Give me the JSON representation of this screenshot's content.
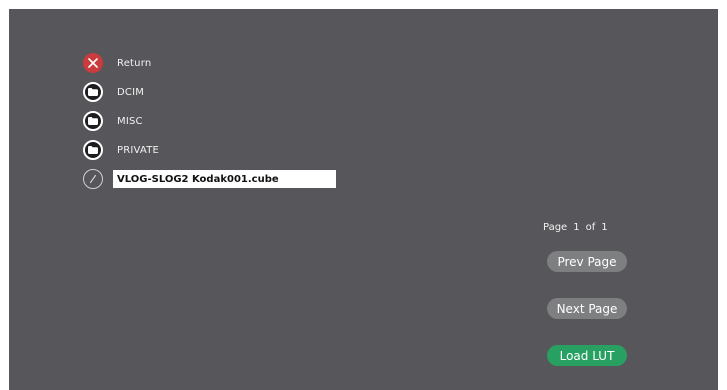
{
  "file_list": {
    "items": [
      {
        "label": "Return",
        "icon": "close-icon"
      },
      {
        "label": "DCIM",
        "icon": "folder-icon"
      },
      {
        "label": "MISC",
        "icon": "folder-icon"
      },
      {
        "label": "PRIVATE",
        "icon": "folder-icon"
      },
      {
        "label": "VLOG-SLOG2 Kodak001.cube",
        "icon": "lut-file-icon"
      }
    ]
  },
  "pager": {
    "page_word": "Page",
    "current": "1",
    "of_word": "of",
    "total": "1"
  },
  "buttons": {
    "prev_page": "Prev Page",
    "next_page": "Next Page",
    "load_lut": "Load LUT"
  },
  "colors": {
    "background": "#57565b",
    "return_icon": "#c93b3c",
    "load_button": "#28a062",
    "nav_button": "#7e7f81"
  }
}
